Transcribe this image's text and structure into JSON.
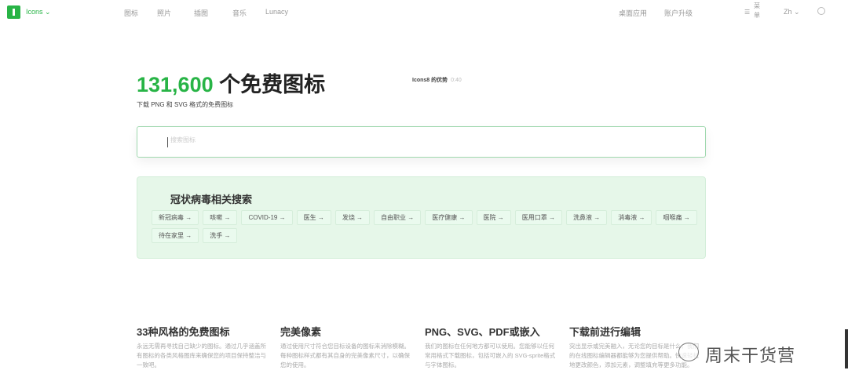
{
  "header": {
    "brand": "Icons ⌄",
    "nav": [
      "图标",
      "照片",
      "插图",
      "音乐",
      "Lunacy"
    ],
    "right": [
      "桌面应用",
      "账户升级"
    ],
    "menu_icon": "☰",
    "menu": "菜单",
    "lang": "Zh ⌄"
  },
  "hero": {
    "count": "131,600",
    "title_rest": " 个免费图标",
    "subtitle": "下载 PNG 和 SVG 格式的免费图标",
    "advantage": "Icons8 的优势",
    "duration": "0:40"
  },
  "search": {
    "placeholder": "搜索图标"
  },
  "covid": {
    "title": "冠状病毒相关搜索",
    "tags": [
      "新冠病毒 →",
      "咳嗽 →",
      "COVID-19 →",
      "医生 →",
      "发烧 →",
      "自由职业 →",
      "医疗健康 →",
      "医院 →",
      "医用口罩 →",
      "洗鼻液 →",
      "消毒液 →",
      "咽喉痛 →",
      "待在家里 →",
      "洗手 →"
    ]
  },
  "features": [
    {
      "title": "33种风格的免费图标",
      "text": "永远无需再寻找自己缺少的图标。通过几乎涵盖所有图标的各类风格图库来确保您的项目保持整洁与一致吧。"
    },
    {
      "title": "完美像素",
      "text": "通过使用尺寸符合您目标设备的图标来消除模糊。每种图标样式都有其自身的完美像素尺寸，以确保您的使用。"
    },
    {
      "title": "PNG、SVG、PDF或嵌入",
      "text": "我们的图标在任何地方都可以使用。您能够以任何常用格式下载图标，包括可嵌入的 SVG-sprite格式与字体图标。"
    },
    {
      "title": "下载前进行编辑",
      "text": "突出显示或完美融入，无论您的目标是什么，我们的在线图标编辑器都能够为您提供帮助。快速轻松地更改颜色，添加元素，调整填充等更多功能。"
    }
  ],
  "watermark": "周末干货营"
}
